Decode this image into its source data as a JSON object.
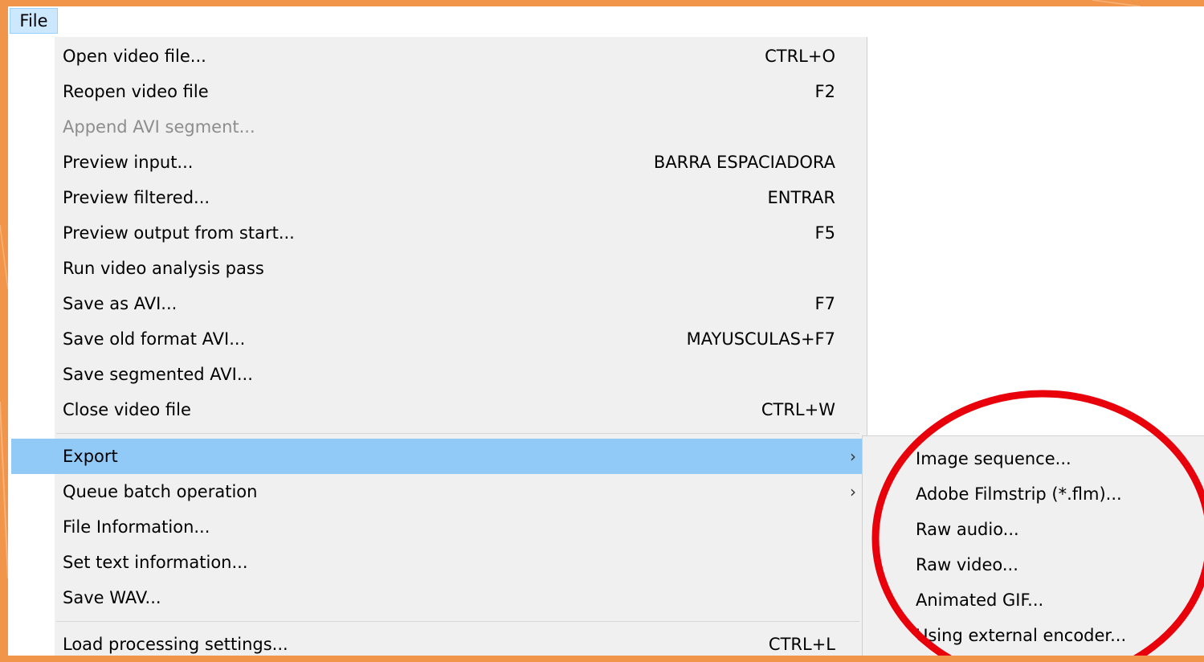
{
  "menubar": {
    "file_label": "File"
  },
  "file_menu": {
    "items": [
      {
        "label": "Open video file...",
        "shortcut": "CTRL+O"
      },
      {
        "label": "Reopen video file",
        "shortcut": "F2"
      },
      {
        "label": "Append AVI segment...",
        "shortcut": ""
      },
      {
        "label": "Preview input...",
        "shortcut": "BARRA ESPACIADORA"
      },
      {
        "label": "Preview filtered...",
        "shortcut": "ENTRAR"
      },
      {
        "label": "Preview output from start...",
        "shortcut": "F5"
      },
      {
        "label": "Run video analysis pass",
        "shortcut": ""
      },
      {
        "label": "Save as AVI...",
        "shortcut": "F7"
      },
      {
        "label": "Save old format AVI...",
        "shortcut": "MAYUSCULAS+F7"
      },
      {
        "label": "Save segmented AVI...",
        "shortcut": ""
      },
      {
        "label": "Close video file",
        "shortcut": "CTRL+W"
      },
      {
        "label": "Export",
        "shortcut": ""
      },
      {
        "label": "Queue batch operation",
        "shortcut": ""
      },
      {
        "label": "File Information...",
        "shortcut": ""
      },
      {
        "label": "Set text information...",
        "shortcut": ""
      },
      {
        "label": "Save WAV...",
        "shortcut": ""
      },
      {
        "label": "Load processing settings...",
        "shortcut": "CTRL+L"
      }
    ],
    "submenu_arrow": "›"
  },
  "export_submenu": {
    "items": [
      {
        "label": "Image sequence..."
      },
      {
        "label": "Adobe Filmstrip (*.flm)..."
      },
      {
        "label": "Raw audio..."
      },
      {
        "label": "Raw video..."
      },
      {
        "label": "Animated GIF..."
      },
      {
        "label": "Using external encoder..."
      }
    ]
  },
  "colors": {
    "background_orange": "#f0954a",
    "highlight_blue": "#91c9f7",
    "annotation_red": "#e8000b",
    "disabled_text": "#8d8d8d"
  }
}
